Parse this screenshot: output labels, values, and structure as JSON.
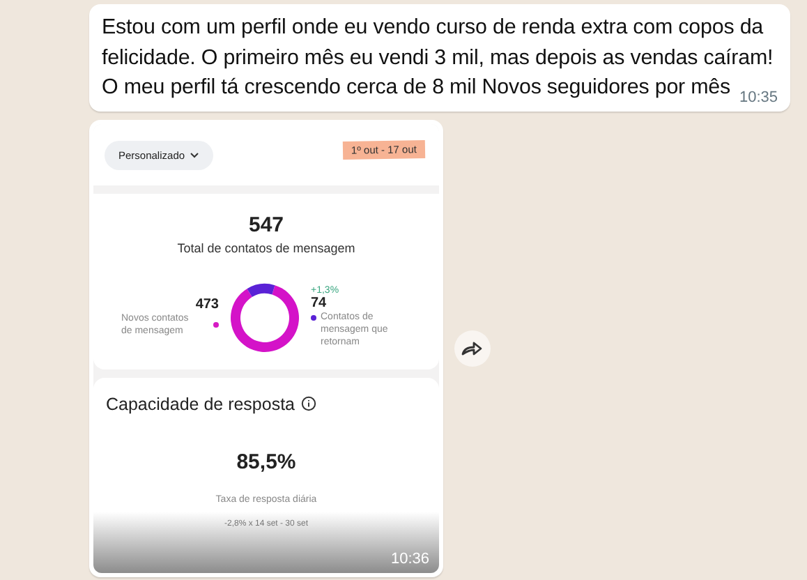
{
  "message": {
    "lines": [
      "Estou com um perfil onde eu vendo curso de renda extra com copos da",
      "felicidade. O primeiro mês eu vendi 3 mil, mas depois as vendas caíram!",
      "O meu perfil tá crescendo cerca de 8 mil Novos seguidores por mês"
    ],
    "time": "10:35"
  },
  "image_message": {
    "time": "10:36",
    "screenshot": {
      "filter": "Personalizado",
      "date_range": "1º out - 17 out",
      "contacts": {
        "total": "547",
        "total_label": "Total de contatos de mensagem",
        "new": {
          "value": "473",
          "label": "Novos contatos de mensagem"
        },
        "returning": {
          "change": "+1,3%",
          "value": "74",
          "label": "Contatos de mensagem que retornam"
        },
        "chart_data": {
          "type": "donut",
          "values": [
            86.5,
            13.5
          ]
        }
      },
      "response": {
        "title": "Capacidade de resposta",
        "value": "85,5%",
        "label": "Taxa de resposta diária",
        "comparison": "-2,8% x 14 set - 30 set"
      }
    }
  }
}
